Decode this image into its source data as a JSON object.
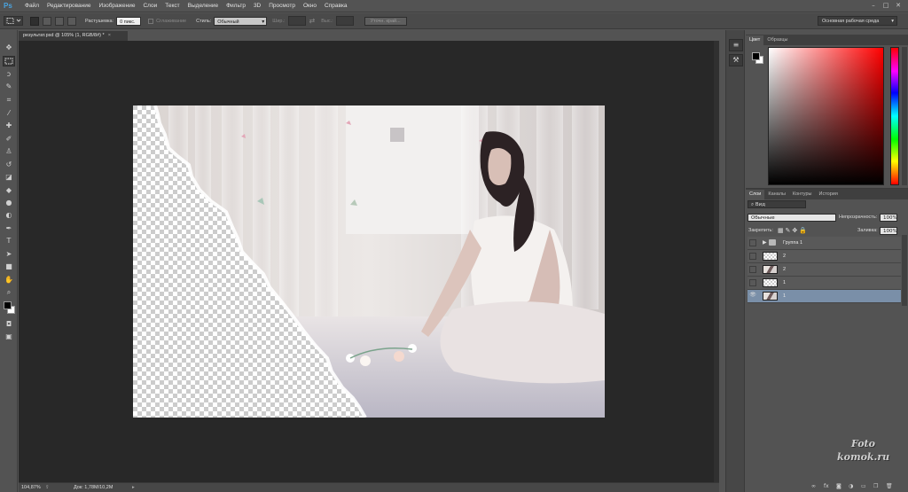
{
  "app": {
    "logo": "Ps"
  },
  "menu": [
    "Файл",
    "Редактирование",
    "Изображение",
    "Слои",
    "Текст",
    "Выделение",
    "Фильтр",
    "3D",
    "Просмотр",
    "Окно",
    "Справка"
  ],
  "window_controls": {
    "minimize": "–",
    "maximize": "□",
    "close": "✕"
  },
  "options": {
    "feather_label": "Растушевка:",
    "feather_value": "0 пикс.",
    "antialias_label": "Сглаживание",
    "style_label": "Стиль:",
    "style_value": "Обычный",
    "width_label": "Шир.:",
    "height_label": "Выс.:",
    "refine_button": "Уточн. край...",
    "workspace": "Основная рабочая среда"
  },
  "document": {
    "tab_title": "результат.psd @ 105% (1, RGB/8#) *",
    "close": "×",
    "zoom": "104,87%",
    "doc_size": "Док: 1,78M/10,2M"
  },
  "color_panel": {
    "tabs": [
      "Цвет",
      "Образцы"
    ],
    "foreground": "#000000",
    "background": "#ffffff"
  },
  "layers_panel": {
    "tabs": [
      "Слои",
      "Каналы",
      "Контуры",
      "История"
    ],
    "filter_kind": "Вид",
    "blend_mode": "Обычные",
    "opacity_label": "Непрозрачность:",
    "opacity_value": "100%",
    "lock_label": "Закрепить:",
    "fill_label": "Заливка:",
    "fill_value": "100%",
    "layers": [
      {
        "name": "Группа 1",
        "kind": "group",
        "visible": false,
        "selected": false
      },
      {
        "name": "2",
        "kind": "transparent",
        "visible": false,
        "selected": false
      },
      {
        "name": "2",
        "kind": "photo",
        "visible": false,
        "selected": false
      },
      {
        "name": "1",
        "kind": "transparent",
        "visible": false,
        "selected": false
      },
      {
        "name": "1",
        "kind": "photo",
        "visible": true,
        "selected": true
      }
    ],
    "footer_icons": [
      "link-icon",
      "fx-icon",
      "mask-icon",
      "adjustment-icon",
      "folder-icon",
      "new-layer-icon",
      "trash-icon"
    ]
  },
  "watermark": {
    "line1": "Foto",
    "line2": "komok.ru"
  }
}
